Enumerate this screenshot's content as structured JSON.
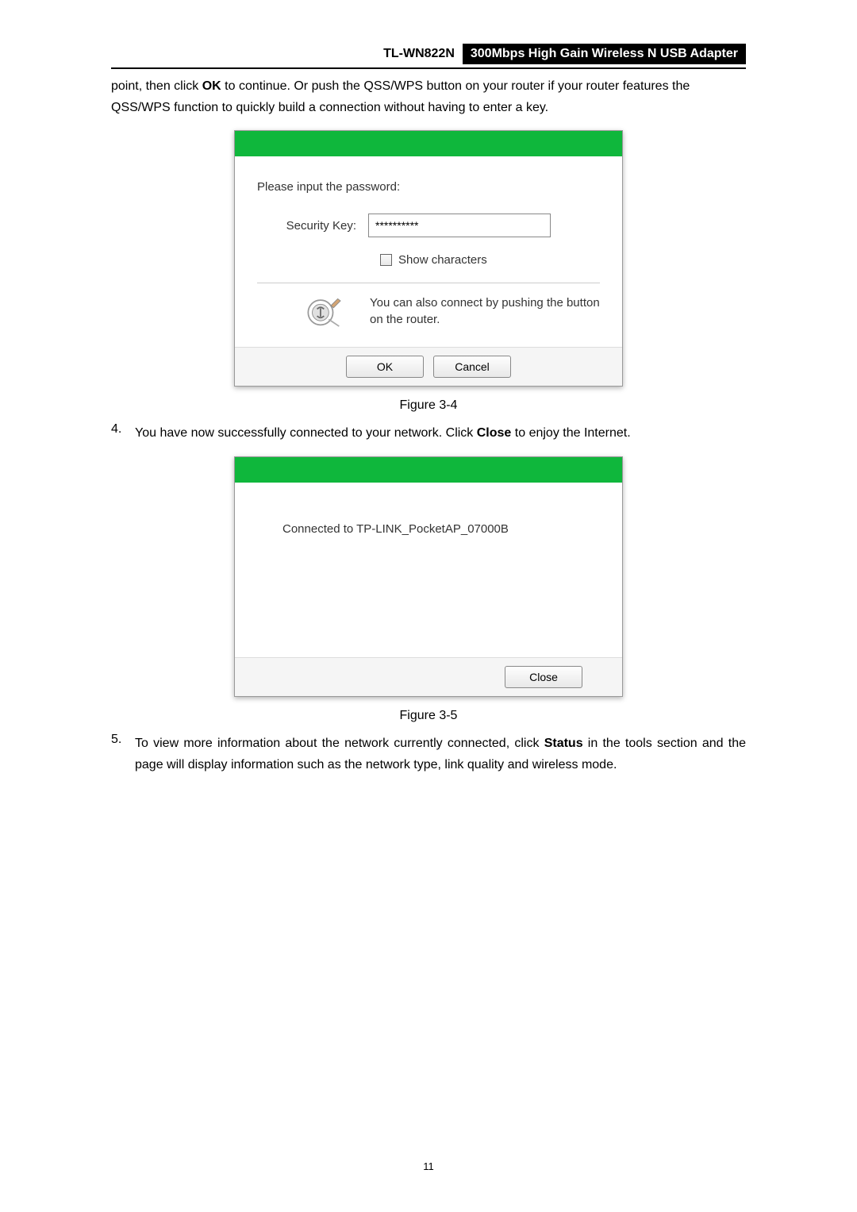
{
  "header": {
    "model": "TL-WN822N",
    "description": "300Mbps High Gain Wireless N USB Adapter"
  },
  "intro": {
    "part1": "point, then click ",
    "bold1": "OK",
    "part2": " to continue. Or push the QSS/WPS button on your router if your router features the QSS/WPS function to quickly build a connection without having to enter a key."
  },
  "dialog1": {
    "prompt": "Please input the password:",
    "security_key_label": "Security Key:",
    "security_key_value": "**********",
    "show_characters": "Show characters",
    "wps_text": "You can also connect by pushing the button on the router.",
    "ok_button": "OK",
    "cancel_button": "Cancel"
  },
  "figure1_caption": "Figure 3-4",
  "step4": {
    "num": "4.",
    "part1": "You have now successfully connected to your network. Click ",
    "bold1": "Close",
    "part2": " to enjoy the Internet."
  },
  "dialog2": {
    "connected_text": "Connected to TP-LINK_PocketAP_07000B",
    "close_button": "Close"
  },
  "figure2_caption": "Figure 3-5",
  "step5": {
    "num": "5.",
    "part1": "To view more information about the network currently connected, click ",
    "bold1": "Status",
    "part2": " in the tools section and the page will display information such as the network type, link quality and wireless mode."
  },
  "page_number": "11"
}
